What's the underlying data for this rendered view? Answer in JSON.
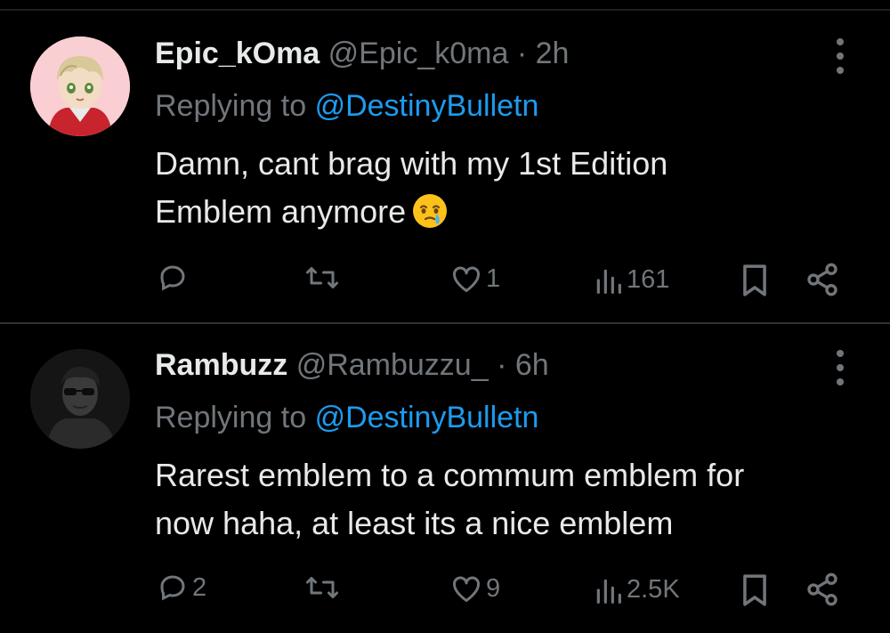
{
  "tweets": [
    {
      "display_name": "Epic_kOma",
      "handle": "@Epic_k0ma",
      "separator": "·",
      "time": "2h",
      "replying_label": "Replying to",
      "replying_to": "@DestinyBulletn",
      "text_line1": "Damn, cant brag with my 1st Edition",
      "text_line2": "Emblem anymore",
      "emoji": "face-holding-back-tears",
      "replies": "",
      "retweets": "",
      "likes": "1",
      "views": "161"
    },
    {
      "display_name": "Rambuzz",
      "handle": "@Rambuzzu_",
      "separator": "·",
      "time": "6h",
      "replying_label": "Replying to",
      "replying_to": "@DestinyBulletn",
      "text_line1": "Rarest emblem to a commum emblem for",
      "text_line2": "now haha, at least its a nice emblem",
      "replies": "2",
      "retweets": "",
      "likes": "9",
      "views": "2.5K"
    }
  ],
  "colors": {
    "background": "#000000",
    "primary_text": "#e7e9ea",
    "secondary_text": "#71767b",
    "link": "#1d9bf0",
    "divider": "#2f3336"
  },
  "icons": [
    "reply-icon",
    "retweet-icon",
    "like-icon",
    "views-icon",
    "bookmark-icon",
    "share-icon",
    "more-icon"
  ]
}
